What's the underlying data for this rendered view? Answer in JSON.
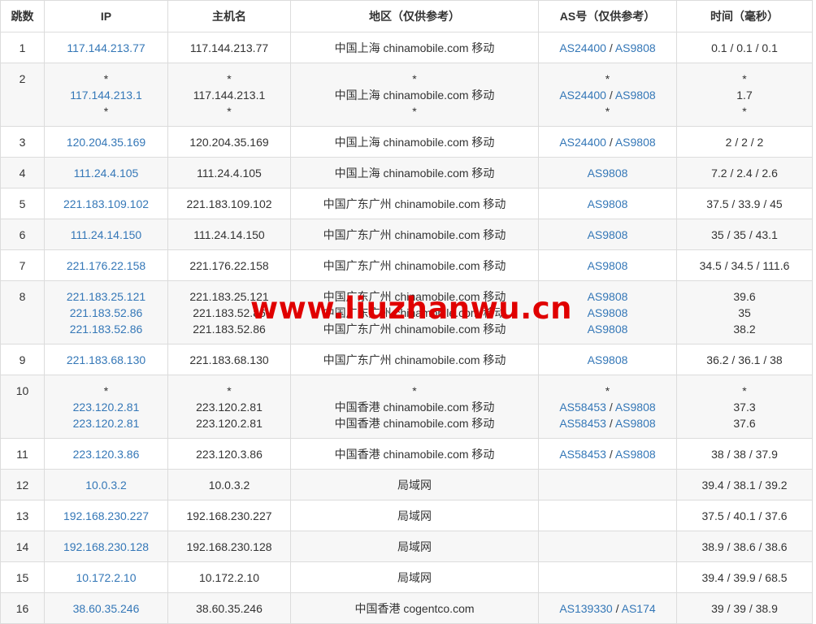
{
  "headers": {
    "hop": "跳数",
    "ip": "IP",
    "host": "主机名",
    "region": "地区（仅供参考）",
    "as": "AS号（仅供参考）",
    "time": "时间（毫秒）"
  },
  "watermark": "www.liuzhanwu.cn",
  "colors": {
    "link": "#3477b7",
    "watermark": "#e00000",
    "band": "#f7f7f7"
  },
  "rows": [
    {
      "hop": "1",
      "ip": [
        "117.144.213.77"
      ],
      "host": [
        "117.144.213.77"
      ],
      "region": [
        "中国上海 chinamobile.com 移动"
      ],
      "as": [
        [
          "AS24400",
          "AS9808"
        ]
      ],
      "time": [
        "0.1 / 0.1 / 0.1"
      ]
    },
    {
      "hop": "2",
      "ip": [
        "*",
        "117.144.213.1",
        "*"
      ],
      "host": [
        "*",
        "117.144.213.1",
        "*"
      ],
      "region": [
        "*",
        "中国上海 chinamobile.com 移动",
        "*"
      ],
      "as": [
        [
          "*"
        ],
        [
          "AS24400",
          "AS9808"
        ],
        [
          "*"
        ]
      ],
      "time": [
        "*",
        "1.7",
        "*"
      ]
    },
    {
      "hop": "3",
      "ip": [
        "120.204.35.169"
      ],
      "host": [
        "120.204.35.169"
      ],
      "region": [
        "中国上海 chinamobile.com 移动"
      ],
      "as": [
        [
          "AS24400",
          "AS9808"
        ]
      ],
      "time": [
        "2 / 2 / 2"
      ]
    },
    {
      "hop": "4",
      "ip": [
        "111.24.4.105"
      ],
      "host": [
        "111.24.4.105"
      ],
      "region": [
        "中国上海 chinamobile.com 移动"
      ],
      "as": [
        [
          "AS9808"
        ]
      ],
      "time": [
        "7.2 / 2.4 / 2.6"
      ]
    },
    {
      "hop": "5",
      "ip": [
        "221.183.109.102"
      ],
      "host": [
        "221.183.109.102"
      ],
      "region": [
        "中国广东广州 chinamobile.com 移动"
      ],
      "as": [
        [
          "AS9808"
        ]
      ],
      "time": [
        "37.5 / 33.9 / 45"
      ]
    },
    {
      "hop": "6",
      "ip": [
        "111.24.14.150"
      ],
      "host": [
        "111.24.14.150"
      ],
      "region": [
        "中国广东广州 chinamobile.com 移动"
      ],
      "as": [
        [
          "AS9808"
        ]
      ],
      "time": [
        "35 / 35 / 43.1"
      ]
    },
    {
      "hop": "7",
      "ip": [
        "221.176.22.158"
      ],
      "host": [
        "221.176.22.158"
      ],
      "region": [
        "中国广东广州 chinamobile.com 移动"
      ],
      "as": [
        [
          "AS9808"
        ]
      ],
      "time": [
        "34.5 / 34.5 / 111.6"
      ]
    },
    {
      "hop": "8",
      "ip": [
        "221.183.25.121",
        "221.183.52.86",
        "221.183.52.86"
      ],
      "host": [
        "221.183.25.121",
        "221.183.52.86",
        "221.183.52.86"
      ],
      "region": [
        "中国广东广州 chinamobile.com 移动",
        "中国广东广州 chinamobile.com 移动",
        "中国广东广州 chinamobile.com 移动"
      ],
      "as": [
        [
          "AS9808"
        ],
        [
          "AS9808"
        ],
        [
          "AS9808"
        ]
      ],
      "time": [
        "39.6",
        "35",
        "38.2"
      ]
    },
    {
      "hop": "9",
      "ip": [
        "221.183.68.130"
      ],
      "host": [
        "221.183.68.130"
      ],
      "region": [
        "中国广东广州 chinamobile.com 移动"
      ],
      "as": [
        [
          "AS9808"
        ]
      ],
      "time": [
        "36.2 / 36.1 / 38"
      ]
    },
    {
      "hop": "10",
      "ip": [
        "*",
        "223.120.2.81",
        "223.120.2.81"
      ],
      "host": [
        "*",
        "223.120.2.81",
        "223.120.2.81"
      ],
      "region": [
        "*",
        "中国香港 chinamobile.com 移动",
        "中国香港 chinamobile.com 移动"
      ],
      "as": [
        [
          "*"
        ],
        [
          "AS58453",
          "AS9808"
        ],
        [
          "AS58453",
          "AS9808"
        ]
      ],
      "time": [
        "*",
        "37.3",
        "37.6"
      ]
    },
    {
      "hop": "11",
      "ip": [
        "223.120.3.86"
      ],
      "host": [
        "223.120.3.86"
      ],
      "region": [
        "中国香港 chinamobile.com 移动"
      ],
      "as": [
        [
          "AS58453",
          "AS9808"
        ]
      ],
      "time": [
        "38 / 38 / 37.9"
      ]
    },
    {
      "hop": "12",
      "ip": [
        "10.0.3.2"
      ],
      "host": [
        "10.0.3.2"
      ],
      "region": [
        "局域网"
      ],
      "as": [],
      "time": [
        "39.4 / 38.1 / 39.2"
      ]
    },
    {
      "hop": "13",
      "ip": [
        "192.168.230.227"
      ],
      "host": [
        "192.168.230.227"
      ],
      "region": [
        "局域网"
      ],
      "as": [],
      "time": [
        "37.5 / 40.1 / 37.6"
      ]
    },
    {
      "hop": "14",
      "ip": [
        "192.168.230.128"
      ],
      "host": [
        "192.168.230.128"
      ],
      "region": [
        "局域网"
      ],
      "as": [],
      "time": [
        "38.9 / 38.6 / 38.6"
      ]
    },
    {
      "hop": "15",
      "ip": [
        "10.172.2.10"
      ],
      "host": [
        "10.172.2.10"
      ],
      "region": [
        "局域网"
      ],
      "as": [],
      "time": [
        "39.4 / 39.9 / 68.5"
      ]
    },
    {
      "hop": "16",
      "ip": [
        "38.60.35.246"
      ],
      "host": [
        "38.60.35.246"
      ],
      "region": [
        "中国香港 cogentco.com"
      ],
      "as": [
        [
          "AS139330",
          "AS174"
        ]
      ],
      "time": [
        "39 / 39 / 38.9"
      ]
    }
  ]
}
